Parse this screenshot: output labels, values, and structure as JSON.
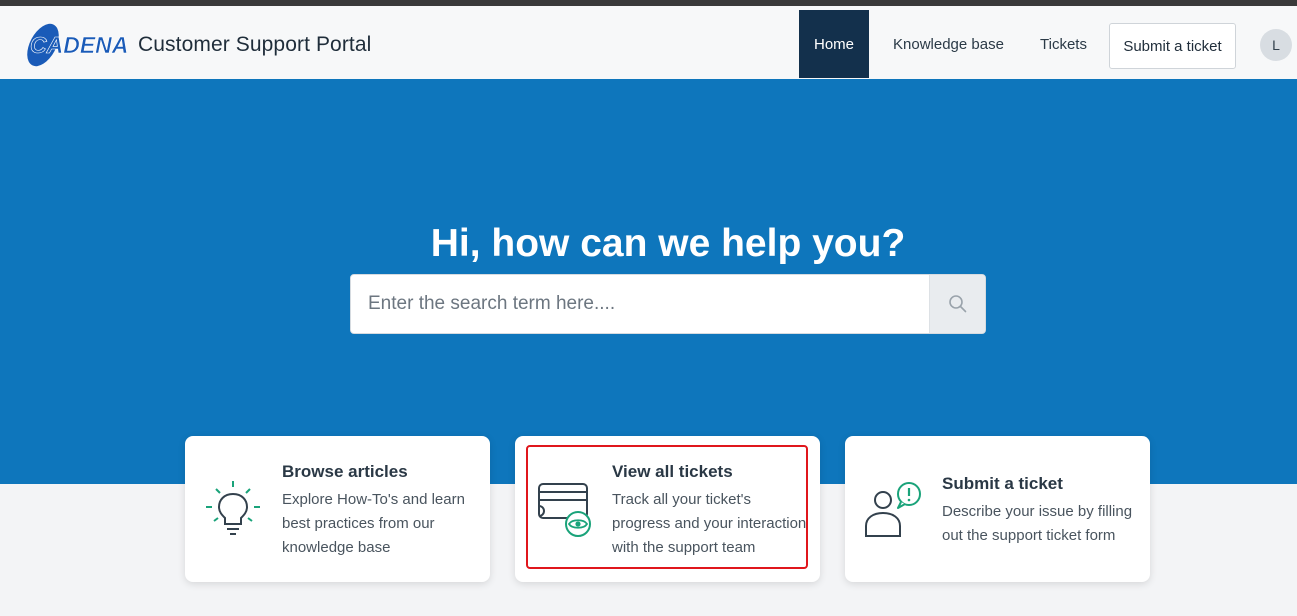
{
  "header": {
    "logo_text": "CADENA",
    "title": "Customer Support Portal",
    "nav": {
      "home": "Home",
      "knowledge_base": "Knowledge base",
      "tickets": "Tickets",
      "submit": "Submit a ticket"
    },
    "avatar_initial": "L"
  },
  "hero": {
    "title": "Hi, how can we help you?",
    "search_placeholder": "Enter the search term here....",
    "search_icon": "search-icon"
  },
  "cards": [
    {
      "title": "Browse articles",
      "description": "Explore How-To's and learn best practices from our knowledge base",
      "icon": "lightbulb-icon"
    },
    {
      "title": "View all tickets",
      "description": "Track all your ticket's progress and your interaction with the support team",
      "icon": "tickets-eye-icon"
    },
    {
      "title": "Submit a ticket",
      "description": "Describe your issue by filling out the support ticket form",
      "icon": "person-alert-icon"
    }
  ],
  "colors": {
    "hero_bg": "#0e76bc",
    "nav_active_bg": "#13304c",
    "icon_accent": "#1aa37a",
    "highlight": "#e0161c"
  }
}
